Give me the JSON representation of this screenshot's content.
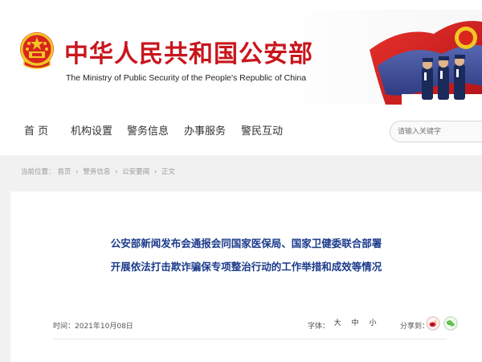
{
  "header": {
    "title": "中华人民共和国公安部",
    "subtitle": "The Ministry of Public Security of the People's Republic of China",
    "brand_color": "#c8161d"
  },
  "nav": {
    "items": [
      {
        "label": "首  页"
      },
      {
        "label": "机构设置"
      },
      {
        "label": "警务信息"
      },
      {
        "label": "办事服务"
      },
      {
        "label": "警民互动"
      }
    ]
  },
  "search": {
    "placeholder": "请输入关键字"
  },
  "breadcrumb": {
    "label": "当前位置：",
    "items": [
      "首页",
      "警务信息",
      "公安要闻",
      "正文"
    ],
    "separator": "›"
  },
  "article": {
    "title_line1": "公安部新闻发布会通报会同国家医保局、国家卫健委联合部署",
    "title_line2": "开展依法打击欺诈骗保专项整治行动的工作举措和成效等情况",
    "time": "时间：2021年10月08日",
    "font_size_label": "字体：",
    "font_sizes": [
      "大",
      "中",
      "小"
    ],
    "share_label": "分享到：",
    "share_icons": [
      "weibo-icon",
      "wechat-icon"
    ],
    "title_color": "#1a3a8a"
  }
}
